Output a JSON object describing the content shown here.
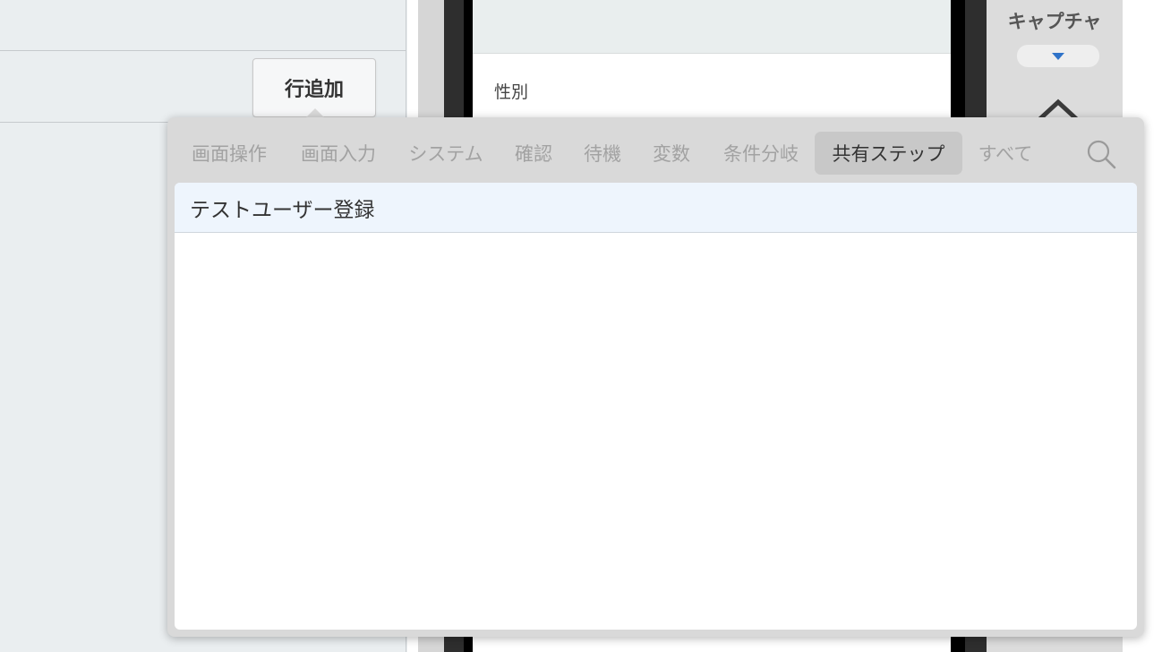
{
  "editor": {
    "add_row_button": "行追加"
  },
  "preview": {
    "field_label": "性別"
  },
  "capture": {
    "title": "キャプチャ",
    "dropdown_accent": "#2f73c9"
  },
  "step_picker": {
    "tabs": [
      {
        "label": "画面操作",
        "active": false
      },
      {
        "label": "画面入力",
        "active": false
      },
      {
        "label": "システム",
        "active": false
      },
      {
        "label": "確認",
        "active": false
      },
      {
        "label": "待機",
        "active": false
      },
      {
        "label": "変数",
        "active": false
      },
      {
        "label": "条件分岐",
        "active": false
      },
      {
        "label": "共有ステップ",
        "active": true
      },
      {
        "label": "すべて",
        "active": false
      }
    ],
    "search_icon": "search-icon",
    "items": [
      {
        "label": "テストユーザー登録",
        "selected": true
      }
    ]
  }
}
